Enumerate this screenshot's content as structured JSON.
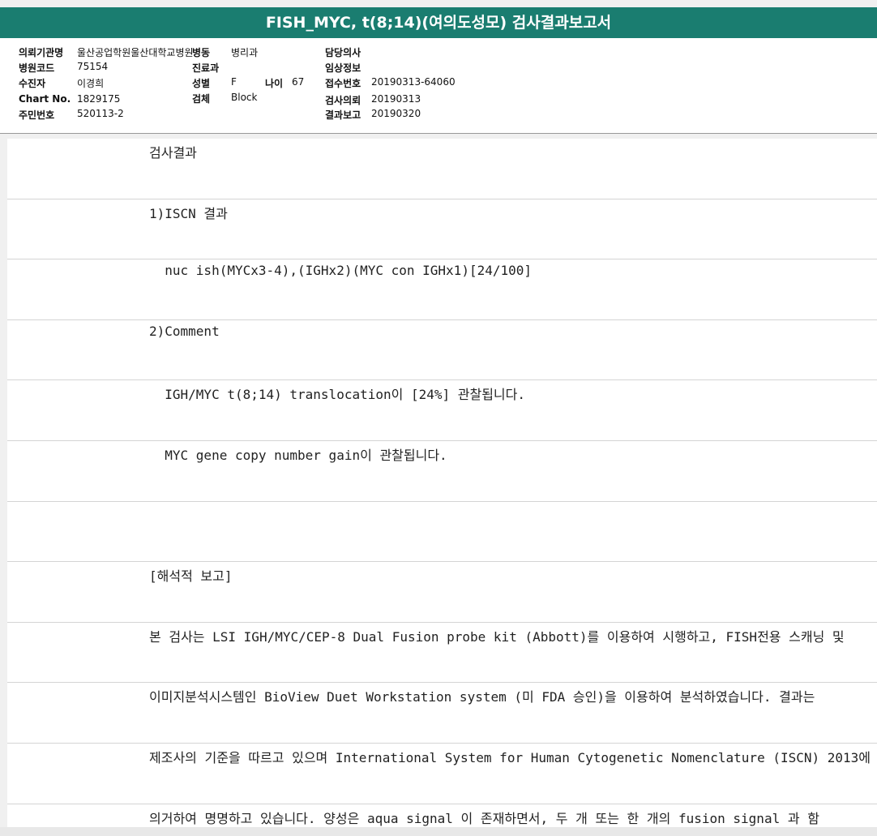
{
  "title": "FISH_MYC, t(8;14)(여의도성모) 검사결과보고서",
  "info": {
    "col1": [
      {
        "label": "의뢰기관명",
        "value": "울산공업학원울산대학교병원"
      },
      {
        "label": "병원코드",
        "value": "75154"
      },
      {
        "label": "수진자",
        "value": "이경희"
      },
      {
        "label": "Chart No.",
        "value": "1829175"
      },
      {
        "label": "주민번호",
        "value": "520113-2"
      }
    ],
    "col2": [
      {
        "label": "병동",
        "value": "병리과"
      },
      {
        "label": "진료과",
        "value": ""
      },
      {
        "label": "성별",
        "value": "F"
      },
      {
        "label": "검체",
        "value": "Block"
      }
    ],
    "age": {
      "label": "나이",
      "value": "67"
    },
    "col3": [
      {
        "label": "담당의사",
        "value": ""
      },
      {
        "label": "임상정보",
        "value": ""
      },
      {
        "label": "접수번호",
        "value": "20190313-64060"
      },
      {
        "label": "검사의뢰",
        "value": "20190313"
      },
      {
        "label": "결과보고",
        "value": "20190320"
      }
    ]
  },
  "report_lines": [
    "검사결과",
    "1)ISCN 결과",
    "  nuc ish(MYCx3-4),(IGHx2)(MYC con IGHx1)[24/100]",
    "2)Comment",
    "  IGH/MYC t(8;14) translocation이 [24%] 관찰됩니다.",
    "  MYC gene copy number gain이 관찰됩니다.",
    "",
    "[해석적 보고]",
    "본 검사는 LSI IGH/MYC/CEP-8 Dual Fusion probe kit (Abbott)를 이용하여 시행하고, FISH전용 스캐닝 및",
    "이미지분석시스템인 BioView Duet Workstation system (미 FDA 승인)을 이용하여 분석하였습니다. 결과는",
    "제조사의 기준을 따르고 있으며 International System for Human Cytogenetic Nomenclature (ISCN) 2013에",
    "의거하여 명명하고 있습니다. 양성은 aqua signal 이 존재하면서, 두 개 또는 한 개의 fusion signal 과 함"
  ]
}
